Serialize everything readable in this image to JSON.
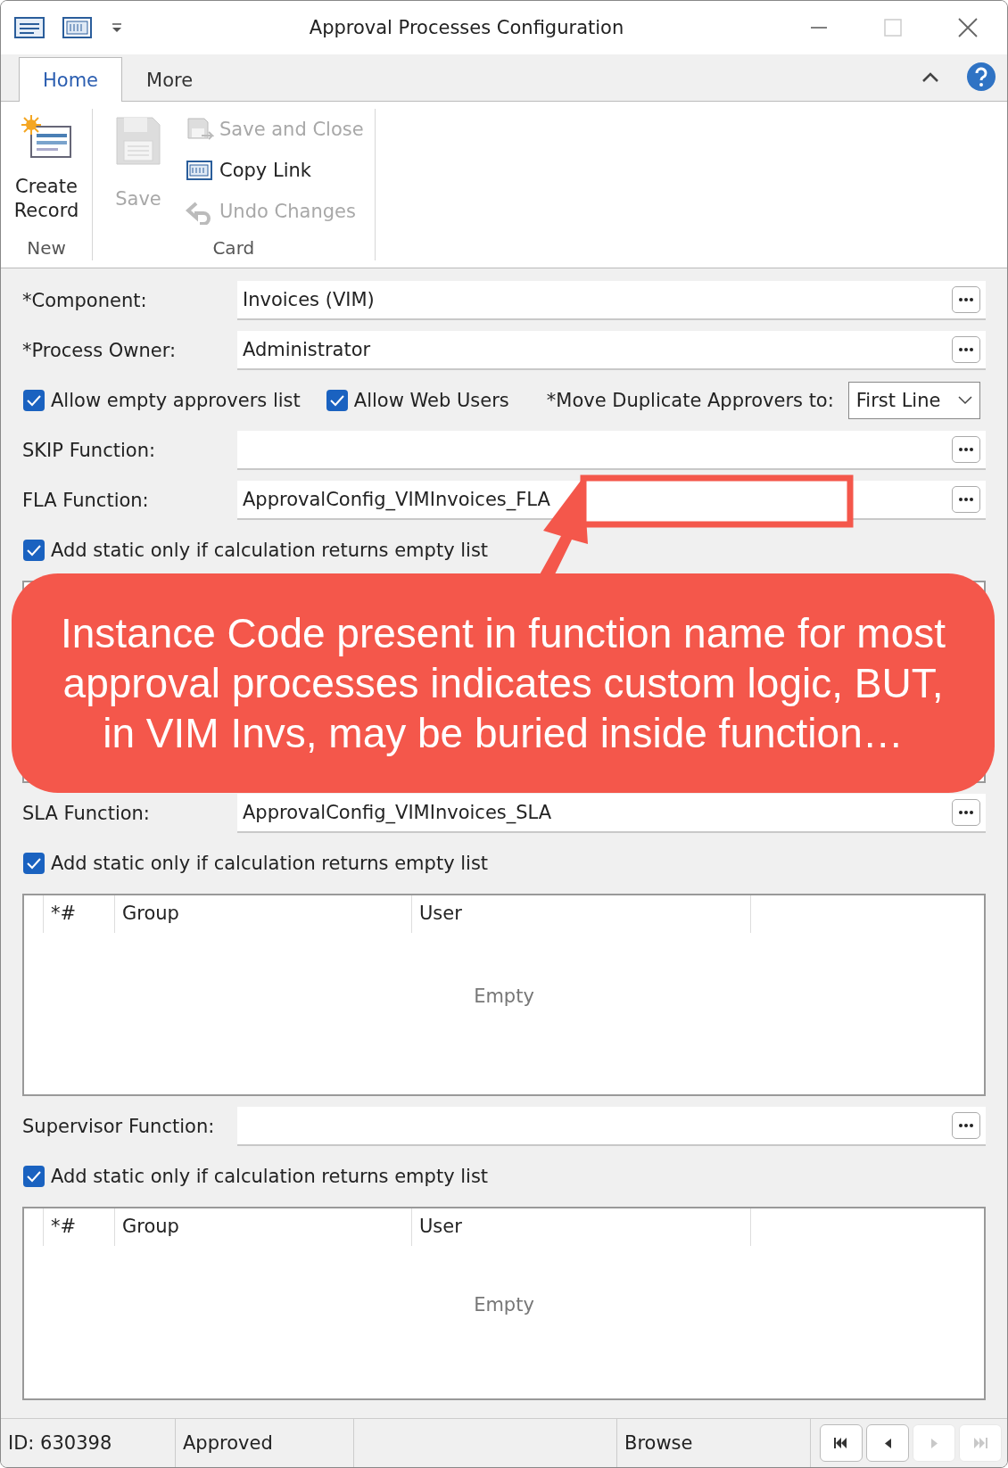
{
  "window": {
    "title": "Approval Processes Configuration"
  },
  "ribbon": {
    "tabs": [
      {
        "label": "Home",
        "selected": true
      },
      {
        "label": "More",
        "selected": false
      }
    ],
    "groups": [
      {
        "label": "New",
        "items": [
          {
            "kind": "large",
            "label": "Create Record",
            "disabled": false
          }
        ]
      },
      {
        "label": "Card",
        "items": [
          {
            "kind": "large",
            "label": "Save",
            "disabled": true
          },
          {
            "kind": "small",
            "label": "Save and Close",
            "disabled": true
          },
          {
            "kind": "small",
            "label": "Copy Link",
            "disabled": false
          },
          {
            "kind": "small",
            "label": "Undo Changes",
            "disabled": true
          }
        ]
      }
    ]
  },
  "form": [
    {
      "kind": "field",
      "label": "*Component:",
      "value": "Invoices (VIM)"
    },
    {
      "kind": "field",
      "label": "*Process Owner:",
      "value": "Administrator"
    },
    {
      "kind": "options",
      "items": [
        {
          "kind": "checkbox",
          "label": "Allow empty approvers list",
          "checked": true
        },
        {
          "kind": "checkbox",
          "label": "Allow Web Users",
          "checked": true
        },
        {
          "kind": "dropdown",
          "label": "*Move Duplicate Approvers to:",
          "value": "First Line"
        }
      ]
    },
    {
      "kind": "field",
      "label": "SKIP Function:"
    },
    {
      "kind": "field",
      "label": "FLA Function:",
      "value": "ApprovalConfig_VIMInvoices_FLA"
    },
    {
      "kind": "checkbox",
      "label": "Add static only if calculation returns empty list",
      "checked": true
    },
    {
      "kind": "table"
    },
    {
      "kind": "field",
      "label": "SLA Function:",
      "value": "ApprovalConfig_VIMInvoices_SLA"
    },
    {
      "kind": "checkbox",
      "label": "Add static only if calculation returns empty list",
      "checked": true
    },
    {
      "kind": "table",
      "columns": [
        "*#",
        "Group",
        "User"
      ],
      "empty_text": "Empty"
    },
    {
      "kind": "field",
      "label": "Supervisor Function:"
    },
    {
      "kind": "checkbox",
      "label": "Add static only if calculation returns empty list",
      "checked": true
    },
    {
      "kind": "table",
      "columns": [
        "*#",
        "Group",
        "User"
      ],
      "empty_text": "Empty"
    }
  ],
  "status_bar": {
    "cells": [
      "ID: 630398",
      "Approved",
      "",
      "Browse"
    ],
    "nav_buttons": [
      {
        "kind": "first",
        "disabled": false
      },
      {
        "kind": "previous",
        "disabled": false
      },
      {
        "kind": "next",
        "disabled": true
      },
      {
        "kind": "last",
        "disabled": true
      }
    ]
  },
  "annotation": {
    "text": "Instance Code present in function name for most approval processes indicates custom logic, BUT, in VIM Invs, may be buried inside function…"
  }
}
